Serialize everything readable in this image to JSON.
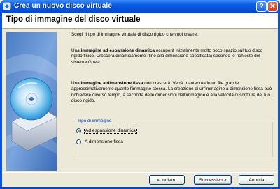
{
  "window": {
    "title": "Crea un nuovo disco virtuale",
    "help_label": "?",
    "close_label": "✕",
    "icon": "wizard-app-icon"
  },
  "header": {
    "title": "Tipo di immagine del disco virtuale"
  },
  "side_image": {
    "icon": "hard-disk-cd-illustration"
  },
  "body": {
    "intro": "Scegli il tipo di immagine virtuale di disco rigido che vuoi creare.",
    "dynamic_term": "immagine ad espansione dinamica",
    "dynamic_pre": "Una ",
    "dynamic_post": " occuperà inizialmente molto poco spazio sul tuo disco rigido fisico. Crescerà dinamicamente (fino alla dimensione specificata) secondo le richieste del sistema Guest.",
    "fixed_term": "immagine a dimensione fissa",
    "fixed_pre": "Una ",
    "fixed_post": " non crescerà. Verrà mantenuta in un file grande approssimativamente quanto l'immagine stessa. La creazione di un'immagine a dimensione fissa può richiedere diverso tempo, a seconda delle dimensioni dell'immagine e alla velocità di scrittura del tuo disco rigido."
  },
  "group": {
    "legend": "Tipo di immagine",
    "options": [
      {
        "label": "Ad espansione dinamica",
        "selected": true
      },
      {
        "label": "A dimensione fissa",
        "selected": false
      }
    ]
  },
  "buttons": {
    "back": "< Indietro",
    "next": "Successivo >",
    "cancel": "Annulla"
  },
  "colors": {
    "titlebar": "#0a53d8",
    "dialog_bg": "#ece9d8",
    "group_legend": "#0046d5",
    "radio_dot": "#21a121"
  }
}
